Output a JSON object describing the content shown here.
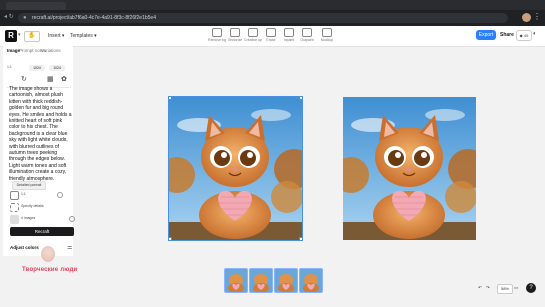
{
  "browser": {
    "url": "recraft.ai/project/ab7f6a0-4c7e-4a91-8f3c-8f26f2e1b5e4",
    "back_icon": "arrow-left-icon",
    "reload_icon": "reload-icon"
  },
  "appbar": {
    "logo": "R",
    "menus": {
      "insert": "Insert",
      "templates": "Templates"
    },
    "tools": [
      {
        "label": "Remove bg"
      },
      {
        "label": "Vectorize"
      },
      {
        "label": "Creative up"
      },
      {
        "label": "Erase"
      },
      {
        "label": "Inpaint"
      },
      {
        "label": "Outpaint"
      },
      {
        "label": "Mockup"
      }
    ],
    "export_label": "Export",
    "share_label": "Share",
    "credits": "49"
  },
  "panel": {
    "tabs": {
      "image": "Image",
      "style": "Prompt notes",
      "variations": "Variations"
    },
    "ratio_label": "1:1",
    "segments": [
      "1024",
      "1024"
    ],
    "description": "The image shows a cartoonish, almost plush kitten with thick reddish-golden fur and big round eyes. He smiles and holds a knitted heart of soft pink color to his chest. The background is a clear blue sky with light white clouds, with blurred outlines of autumn trees peeking through the edges below. Light warm tones and soft illumination create a cozy, friendly atmosphere.",
    "style_tag": "Detailed portrait",
    "options": [
      {
        "label": "1:1"
      },
      {
        "label": "Specify details"
      },
      {
        "label": "4 images"
      }
    ],
    "recraft_label": "Recraft",
    "adjust_label": "Adjust colors"
  },
  "watermark": "Творческие люди",
  "canvas": {
    "images": 2,
    "thumbnails": 4,
    "zoom": "58%"
  },
  "colors": {
    "accent": "#2b7fff",
    "watermark": "#e0435a",
    "dark_button": "#1b1b1d"
  }
}
